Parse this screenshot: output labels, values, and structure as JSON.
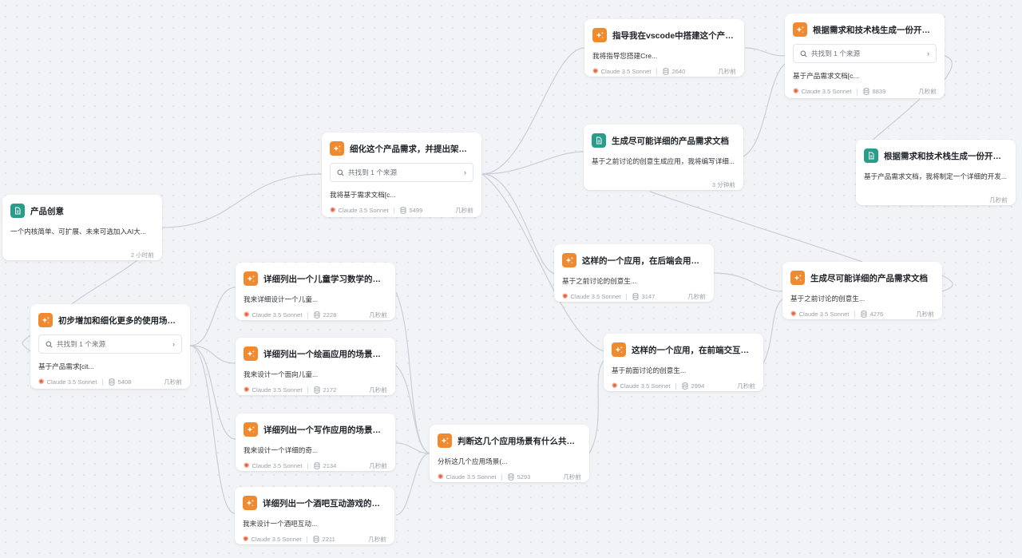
{
  "icons": {
    "ai": "sparkle-icon",
    "doc": "document-icon",
    "search": "search-icon",
    "chevron": "chevron-right-icon",
    "model": "claude-logo-icon",
    "tokens": "database-icon"
  },
  "colors": {
    "ai_icon": "#ef8a2e",
    "doc_icon": "#279d8a",
    "model_logo": "#e5603a"
  },
  "nodes": {
    "n1": {
      "title": "产品创意",
      "body": "一个内核简单、可扩展、未来可选加入AI大...",
      "time": "2 小时前"
    },
    "n2": {
      "title": "初步增加和细化更多的使用场景，...",
      "search": "共找到 1 个来源",
      "body": "基于产品需求[cit...",
      "model": "Claude 3.5 Sonnet",
      "tokens": "5408",
      "time": "几秒前"
    },
    "n3": {
      "title": "细化这个产品需求，并提出架构建...",
      "search": "共找到 1 个来源",
      "body": "我将基于需求文档[c...",
      "model": "Claude 3.5 Sonnet",
      "tokens": "5499",
      "time": "几秒前"
    },
    "n4": {
      "title": "详细列出一个儿童学习数学的应用...",
      "body": "我来详细设计一个儿童...",
      "model": "Claude 3.5 Sonnet",
      "tokens": "2228",
      "time": "几秒前"
    },
    "n5": {
      "title": "详细列出一个绘画应用的场景使用...",
      "body": "我来设计一个面向儿童...",
      "model": "Claude 3.5 Sonnet",
      "tokens": "2172",
      "time": "几秒前"
    },
    "n6": {
      "title": "详细列出一个写作应用的场景使用...",
      "body": "我来设计一个详细的奇...",
      "model": "Claude 3.5 Sonnet",
      "tokens": "2134",
      "time": "几秒前"
    },
    "n7": {
      "title": "详细列出一个酒吧互动游戏的规则...",
      "body": "我来设计一个酒吧互动...",
      "model": "Claude 3.5 Sonnet",
      "tokens": "2211",
      "time": "几秒前"
    },
    "n8": {
      "title": "判断这几个应用场景有什么共同点...",
      "body": "分析这几个应用场景(...",
      "model": "Claude 3.5 Sonnet",
      "tokens": "5293",
      "time": "几秒前"
    },
    "n9": {
      "title": "指导我在vscode中搭建这个产品的...",
      "body": "我将指导您搭建Cre...",
      "model": "Claude 3.5 Sonnet",
      "tokens": "2640",
      "time": "几秒前"
    },
    "n10": {
      "title": "生成尽可能详细的产品需求文档",
      "body": "基于之前讨论的创意生成应用，我将编写详细...",
      "time": "3 分钟前"
    },
    "n11": {
      "title": "这样的一个应用，在后端会用到哪...",
      "body": "基于之前讨论的创意生...",
      "model": "Claude 3.5 Sonnet",
      "tokens": "3147",
      "time": "几秒前"
    },
    "n12": {
      "title": "这样的一个应用，在前端交互上适...",
      "body": "基于前面讨论的创意生...",
      "model": "Claude 3.5 Sonnet",
      "tokens": "2994",
      "time": "几秒前"
    },
    "n13": {
      "title": "根据需求和技术栈生成一份开发计...",
      "search": "共找到 1 个来源",
      "body": "基于产品需求文档[c...",
      "model": "Claude 3.5 Sonnet",
      "tokens": "8839",
      "time": "几秒前"
    },
    "n14": {
      "title": "根据需求和技术栈生成一份开发计...",
      "body": "基于产品需求文档，我将制定一个详细的开发...",
      "time": "几秒前"
    },
    "n15": {
      "title": "生成尽可能详细的产品需求文档",
      "body": "基于之前讨论的创意生...",
      "model": "Claude 3.5 Sonnet",
      "tokens": "4276",
      "time": "几秒前"
    }
  }
}
